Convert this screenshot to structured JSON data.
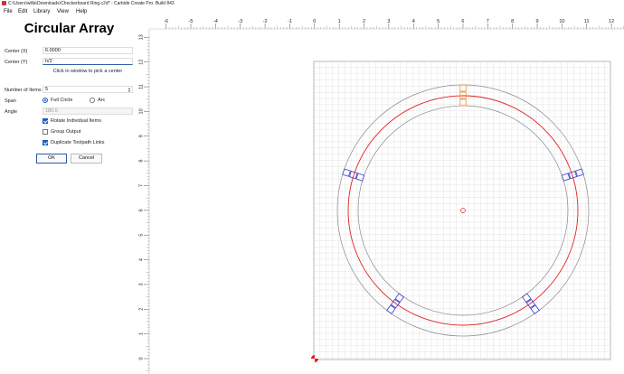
{
  "window": {
    "title": "C:\\Users\\willa\\Downloads\\Checkerboard Ring.c2d* - Carbide Create Pro. Build 843"
  },
  "menu": [
    "File",
    "Edit",
    "Library",
    "View",
    "Help"
  ],
  "panel": {
    "heading": "Circular Array",
    "center_x_label": "Center (X)",
    "center_x_value": "6.0000",
    "center_y_label": "Center (Y)",
    "center_y_value": "h/2",
    "pick_hint": "Click in window to pick a center",
    "num_items_label": "Number of Items",
    "num_items_value": "5",
    "span_label": "Span",
    "span_full": "Full Circle",
    "span_arc": "Arc",
    "angle_label": "Angle",
    "angle_value": "180.0",
    "rotate_label": "Rotate Individual Items",
    "group_label": "Group Output",
    "dup_label": "Duplicate Toolpath Links",
    "ok_label": "OK",
    "cancel_label": "Cancel"
  },
  "state": {
    "span": "full",
    "rotate": true,
    "group": false,
    "duplicate": true
  },
  "ruler": {
    "x_ticks": [
      "-6",
      "-5",
      "-4",
      "-3",
      "-2",
      "-1",
      "0",
      "1",
      "2",
      "3",
      "4",
      "5",
      "6",
      "7",
      "8",
      "9",
      "10",
      "11",
      "12"
    ],
    "y_ticks": [
      "13",
      "12",
      "11",
      "10",
      "9",
      "8",
      "7",
      "6",
      "5",
      "4",
      "3",
      "2",
      "1",
      "0"
    ]
  },
  "colors": {
    "ring": "#8a8a8a",
    "path": "#e02020",
    "item": "#3a3ad0",
    "selected_item": "#f09030",
    "grid": "#dcdcdc",
    "accent": "#1d5fbf"
  }
}
